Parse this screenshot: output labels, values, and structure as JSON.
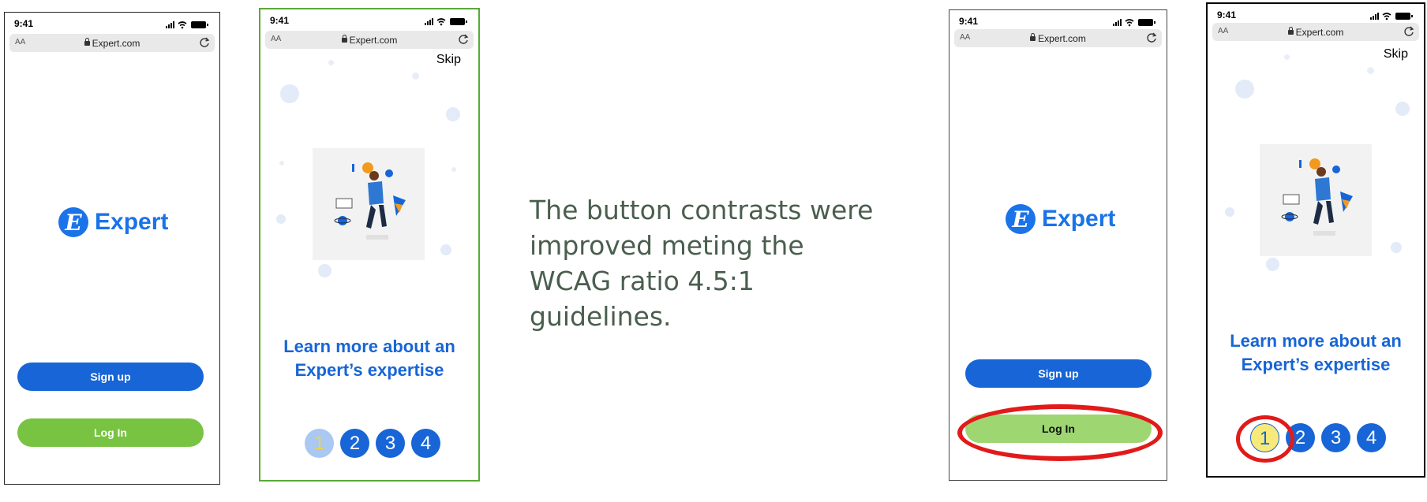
{
  "status_time": "9:41",
  "url_aa": "AA",
  "url_text": "Expert.com",
  "logo_letter": "E",
  "brand": "Expert",
  "sign_up": "Sign up",
  "log_in": "Log In",
  "skip": "Skip",
  "learn_line1": "Learn more about an",
  "learn_line2": "Expert’s expertise",
  "pages": [
    "1",
    "2",
    "3",
    "4"
  ],
  "caption": "The button contrasts were improved meting the WCAG ratio 4.5:1 guidelines.",
  "colors": {
    "brand_blue": "#1765d6",
    "login_green_before": "#78c342",
    "login_green_after": "#9ed672",
    "page1_before": "#a9c8f2",
    "page1_before_text": "#f1d34a",
    "page1_after": "#f8ea7a",
    "highlight_red": "#e21a1a",
    "frame_green": "#5aa93a",
    "caption_color": "#4a5e4e"
  }
}
